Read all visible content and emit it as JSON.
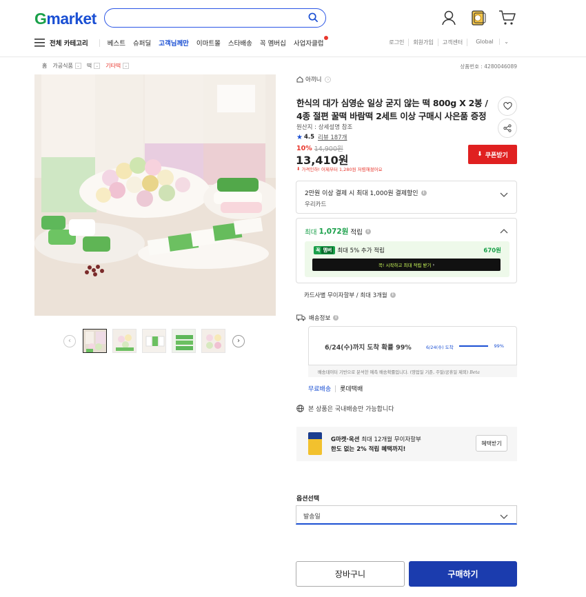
{
  "header": {
    "logo_g": "G",
    "logo_rest": "market",
    "search": {
      "value": "",
      "icon": "search-icon"
    },
    "icons": [
      "user-icon",
      "coupon-icon",
      "cart-icon"
    ]
  },
  "nav": {
    "all_category": "전체 카테고리",
    "items": [
      "베스트",
      "슈퍼딜",
      "고객님께만",
      "이마트몰",
      "스타배송",
      "꼭 멤버십",
      "사업자클럽"
    ],
    "links": [
      "로그인",
      "회원가입",
      "고객센터",
      "Global"
    ]
  },
  "breadcrumb": {
    "items": [
      "홈",
      "가공식품",
      "떡",
      "기타떡"
    ],
    "product_no": "상품번호 : 4280046089"
  },
  "product": {
    "store": "아끼니",
    "title": "한식의 대가 심영순 일상 굳지 않는 떡 800g X 2봉 / 4종 절편 꿀떡 바람떡 2세트 이상 구매시 사은품 증정",
    "origin": "원산지 : 상세설명 참조",
    "rating": "4.5",
    "reviews": "리뷰 187개",
    "discount_pct": "10%",
    "orig_price": "14,900원",
    "price": "13,410원",
    "price_note": "가격인하! 어제부터 1,280원 저렴해졌어요",
    "coupon_btn": "쿠폰받기"
  },
  "card_discount": {
    "title": "2만원 이상 결제 시 최대 1,000원 결제할인",
    "card": "우리카드"
  },
  "points": {
    "prefix": "최대",
    "amount": "1,072원",
    "suffix": "적립",
    "club_badge": "꼭",
    "club_badge2": "멤버",
    "club_text": "최대 5% 추가 적립",
    "club_amount": "670원",
    "club_bar": "꼭! 시작하고 최대 적립 받기"
  },
  "installment": "카드사별 무이자할부 / 최대 3개월",
  "shipping": {
    "title": "배송정보",
    "arrival": "6/24(수)까지 도착 확률 99%",
    "arrival_small": "6/24(수) 도착",
    "probability": "99%",
    "probability_value": 0.99,
    "note": "배송데이터 기반으로 분석한 예측 배송확률입니다. (영업일 기준, 주말/공휴일 제외)",
    "note_brand": "Beta",
    "free": "무료배송",
    "carrier": "롯데택배",
    "domestic": "본 상품은 국내배송만 가능합니다"
  },
  "promo": {
    "l1_bold": "G마켓·옥션",
    "l1_rest": "최대 12개월 무이자할부",
    "l2": "한도 없는 2% 적립 혜택까지!",
    "btn": "혜택받기"
  },
  "option": {
    "label": "옵션선택",
    "value": "발송일"
  },
  "actions": {
    "cart": "장바구니",
    "buy": "구매하기"
  },
  "colors": {
    "brand_green": "#1aa04a",
    "brand_blue": "#1a4fd3",
    "sale_red": "#e8372d",
    "buy_blue": "#1b3cae"
  }
}
